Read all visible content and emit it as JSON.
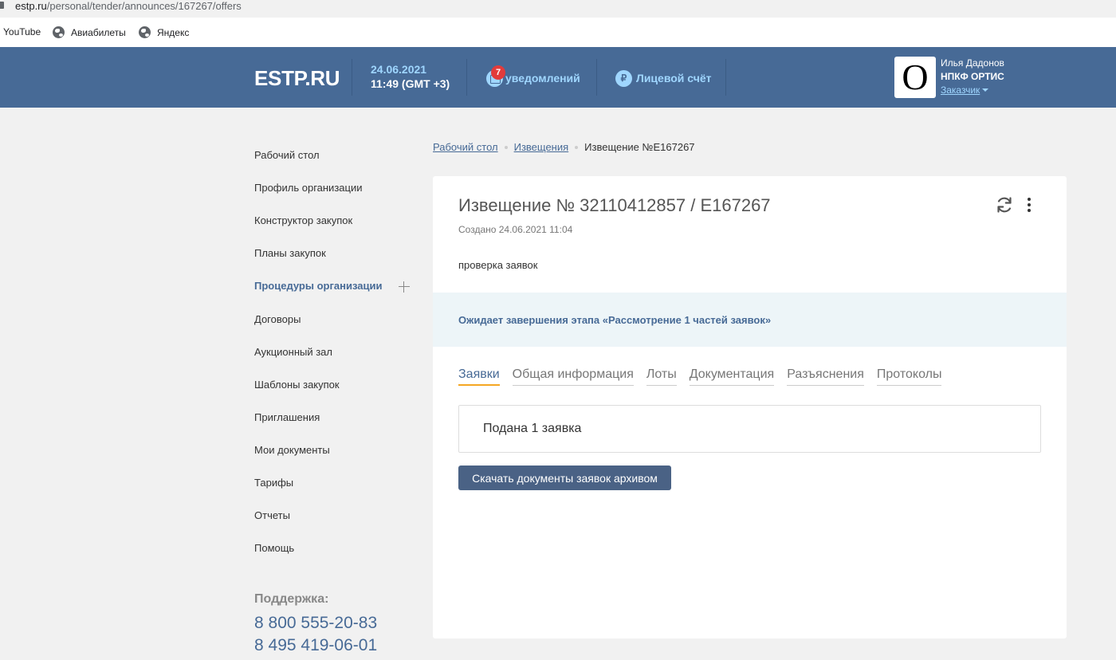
{
  "browser": {
    "url_host": "estp.ru",
    "url_path": "/personal/tender/announces/167267/offers",
    "bookmarks": [
      {
        "label": "YouTube"
      },
      {
        "label": "Авиабилеты"
      },
      {
        "label": "Яндекс"
      }
    ]
  },
  "header": {
    "logo": "ESTP.RU",
    "date": "24.06.2021",
    "time": "11:49 (GMT +3)",
    "notifications_count": "7",
    "notifications_label": "уведомлений",
    "account_icon": "₽",
    "account_label": "Лицевой счёт",
    "avatar_letter": "O",
    "user_name": "Илья Дадонов",
    "org_name": "НПКФ ОРТИС",
    "role": "Заказчик",
    "colors": {
      "header_bg": "#476a96",
      "accent_light": "#9fd6ff",
      "badge": "#e23b3b"
    }
  },
  "sidebar": {
    "items": [
      {
        "label": "Рабочий стол"
      },
      {
        "label": "Профиль организации"
      },
      {
        "label": "Конструктор закупок"
      },
      {
        "label": "Планы закупок"
      },
      {
        "label": "Процедуры организации"
      },
      {
        "label": "Договоры"
      },
      {
        "label": "Аукционный зал"
      },
      {
        "label": "Шаблоны закупок"
      },
      {
        "label": "Приглашения"
      },
      {
        "label": "Мои документы"
      },
      {
        "label": "Тарифы"
      },
      {
        "label": "Отчеты"
      },
      {
        "label": "Помощь"
      }
    ],
    "active_item": "Процедуры организации",
    "support_title": "Поддержка:",
    "phones": [
      "8 800 555-20-83",
      "8 495 419-06-01"
    ]
  },
  "breadcrumb": {
    "items": [
      "Рабочий стол",
      "Извещения"
    ],
    "current": "Извещение №Е167267"
  },
  "notice": {
    "title": "Извещение № 32110412857 / Е167267",
    "created": "Создано 24.06.2021 11:04",
    "description": "проверка заявок",
    "status": "Ожидает завершения этапа «Рассмотрение 1 частей заявок»",
    "tabs": [
      {
        "label": "Заявки"
      },
      {
        "label": "Общая информация"
      },
      {
        "label": "Лоты"
      },
      {
        "label": "Документация"
      },
      {
        "label": "Разъяснения"
      },
      {
        "label": "Протоколы"
      }
    ],
    "active_tab": "Заявки",
    "offers_summary": "Подана 1 заявка",
    "download_button": "Скачать документы заявок архивом",
    "icons": [
      "refresh-icon",
      "more-vertical-icon"
    ]
  }
}
